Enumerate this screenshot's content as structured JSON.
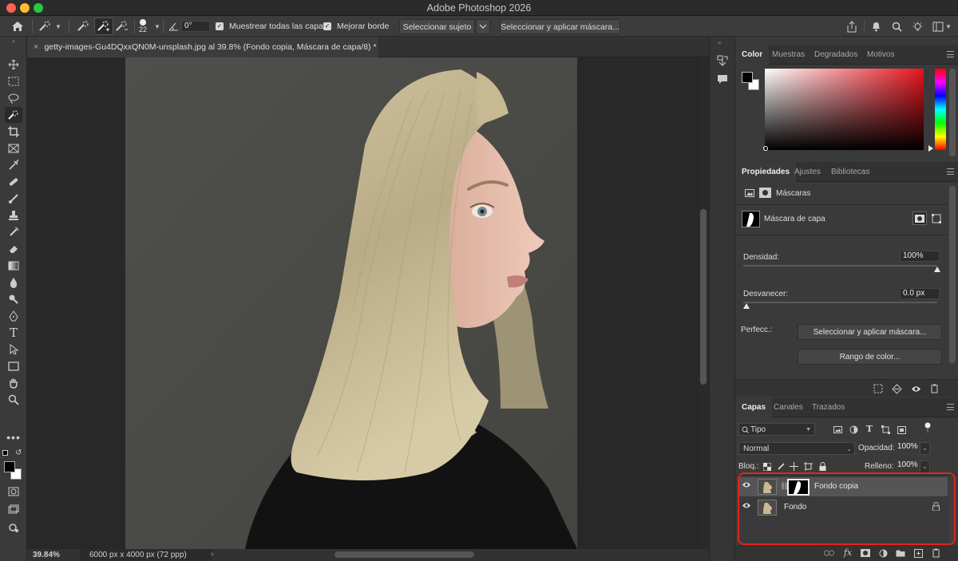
{
  "window": {
    "title": "Adobe Photoshop 2026"
  },
  "options_bar": {
    "brush_size": "22",
    "angle": "0°",
    "sample_all_label": "Muestrear todas las capas",
    "enhance_edge_label": "Mejorar borde",
    "select_subject_label": "Seleccionar sujeto",
    "select_mask_label": "Seleccionar y aplicar máscara..."
  },
  "document": {
    "tab_title": "getty-images-Gu4DQxxQN0M-unsplash.jpg al 39.8% (Fondo copia, Máscara de capa/8) *",
    "zoom": "39.84%",
    "dimensions": "6000 px x 4000 px (72 ppp)"
  },
  "color_panel": {
    "tabs": [
      "Color",
      "Muestras",
      "Degradados",
      "Motivos"
    ]
  },
  "properties_panel": {
    "tabs": [
      "Propiedades",
      "Ajustes",
      "Bibliotecas"
    ],
    "section_label": "Máscaras",
    "mask_label": "Máscara de capa",
    "density_label": "Densidad:",
    "density_value": "100%",
    "density_level": 1.0,
    "feather_label": "Desvanecer:",
    "feather_value": "0.0 px",
    "feather_level": 0.0,
    "refine_label": "Perfecc.:",
    "select_mask_button": "Seleccionar y aplicar máscara...",
    "color_range_button": "Rango de color..."
  },
  "layers_panel": {
    "tabs": [
      "Capas",
      "Canales",
      "Trazados"
    ],
    "filter_label": "Tipo",
    "blend_mode": "Normal",
    "opacity_label": "Opacidad:",
    "opacity_value": "100%",
    "lock_label": "Bloq.:",
    "fill_label": "Relleno:",
    "fill_value": "100%",
    "layers": [
      {
        "name": "Fondo copia",
        "has_mask": true,
        "selected": true
      },
      {
        "name": "Fondo",
        "locked": true,
        "selected": false
      }
    ],
    "highlight_color": "#e0241b"
  }
}
